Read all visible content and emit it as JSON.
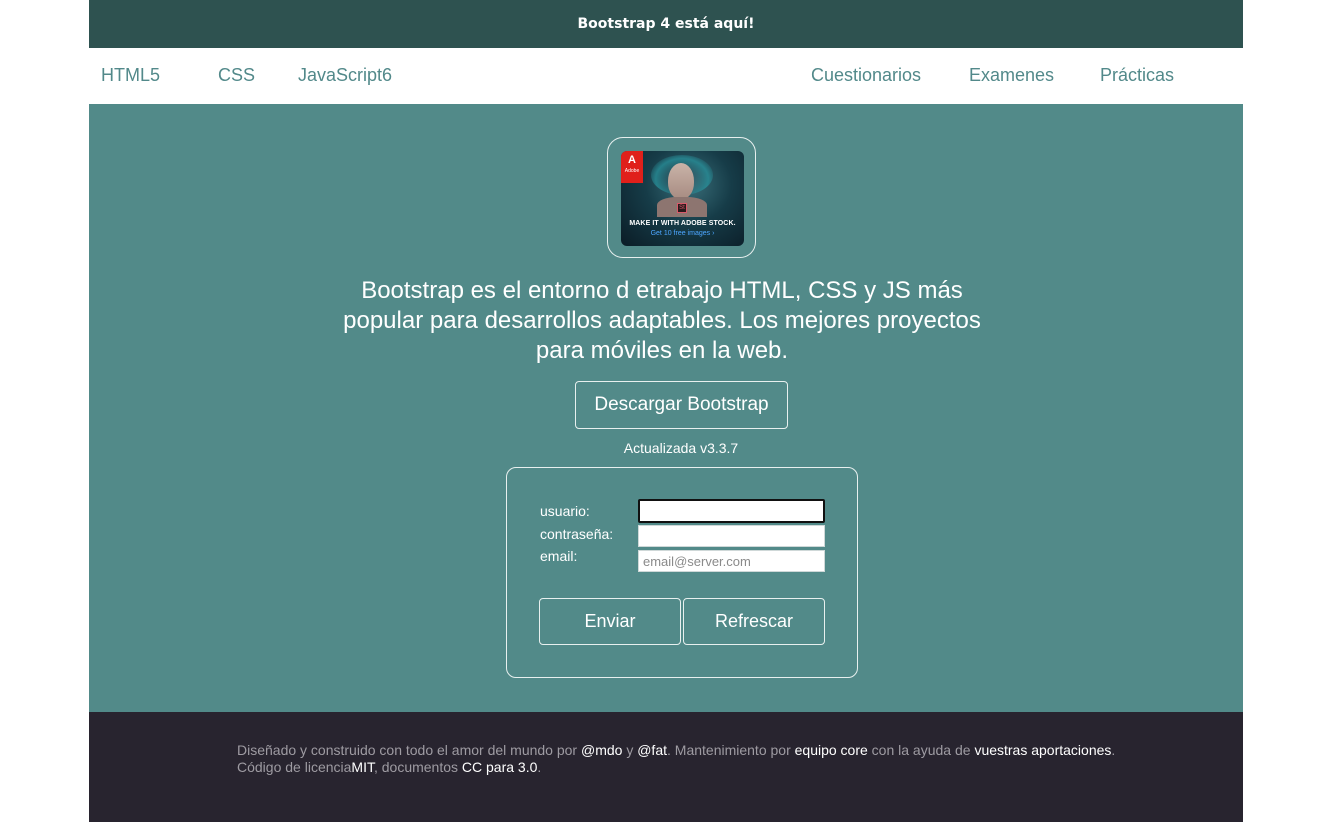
{
  "banner": {
    "text": "Bootstrap 4 está aquí!"
  },
  "nav": {
    "left": [
      "HTML5",
      "CSS",
      "JavaScript6"
    ],
    "right": [
      "Cuestionarios",
      "Examenes",
      "Prácticas"
    ]
  },
  "ad": {
    "logo_letter": "A",
    "logo_word": "Adobe",
    "product_badge": "St",
    "headline": "MAKE IT WITH ADOBE STOCK.",
    "cta": "Get 10 free images ›"
  },
  "hero": {
    "text": "Bootstrap es el entorno d etrabajo HTML, CSS y JS más popular para desarrollos adaptables. Los mejores proyectos para móviles en la web.",
    "download_label": "Descargar Bootstrap",
    "version": "Actualizada v3.3.7"
  },
  "form": {
    "user_label": "usuario:",
    "password_label": "contraseña:",
    "email_label": "email:",
    "user_value": "",
    "password_value": "",
    "email_value": "",
    "email_placeholder": "email@server.com",
    "submit_label": "Enviar",
    "reset_label": "Refrescar"
  },
  "footer": {
    "t1": "Diseñado y construido con todo el amor del mundo por ",
    "mdo": "@mdo",
    "t2": " y ",
    "fat": "@fat",
    "t3": ". Mantenimiento por ",
    "core": "equipo core",
    "t4": " con la ayuda de ",
    "contrib": "vuestras aportaciones",
    "t5": ".",
    "t6": "Código de licencia",
    "mit": "MIT",
    "t7": ", documentos ",
    "cc": "CC para 3.0",
    "t8": "."
  },
  "colors": {
    "banner_bg": "#2e5250",
    "hero_bg": "#528a89",
    "nav_text": "#52898a",
    "footer_bg": "#28242f"
  }
}
